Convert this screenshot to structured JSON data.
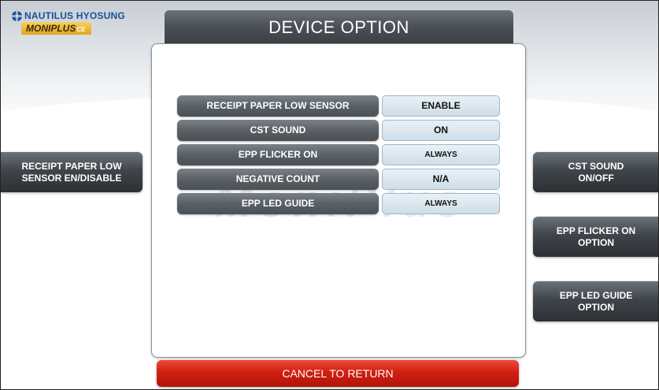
{
  "logo": {
    "brand": "NAUTILUS HYOSUNG",
    "product": "MONIPLUS",
    "product_suffix": "CE"
  },
  "header": {
    "title": "DEVICE OPTION"
  },
  "watermark": "MoniPlus",
  "options": [
    {
      "label": "RECEIPT PAPER LOW SENSOR",
      "value": "ENABLE"
    },
    {
      "label": "CST SOUND",
      "value": "ON"
    },
    {
      "label": "EPP FLICKER ON",
      "value": "ALWAYS"
    },
    {
      "label": "NEGATIVE COUNT",
      "value": "N/A"
    },
    {
      "label": "EPP LED GUIDE",
      "value": "ALWAYS"
    }
  ],
  "left_buttons": [
    {
      "line1": "RECEIPT PAPER LOW",
      "line2": "SENSOR EN/DISABLE"
    }
  ],
  "right_buttons": [
    {
      "line1": "CST SOUND",
      "line2": "ON/OFF"
    },
    {
      "line1": "EPP FLICKER ON",
      "line2": "OPTION"
    },
    {
      "line1": "EPP LED GUIDE",
      "line2": "OPTION"
    }
  ],
  "footer": {
    "cancel_label": "CANCEL TO RETURN"
  },
  "colors": {
    "title_bar": "#4b5157",
    "cancel_button": "#d21f12",
    "value_box": "#cfdde7",
    "brand_blue": "#1b4f9c"
  }
}
